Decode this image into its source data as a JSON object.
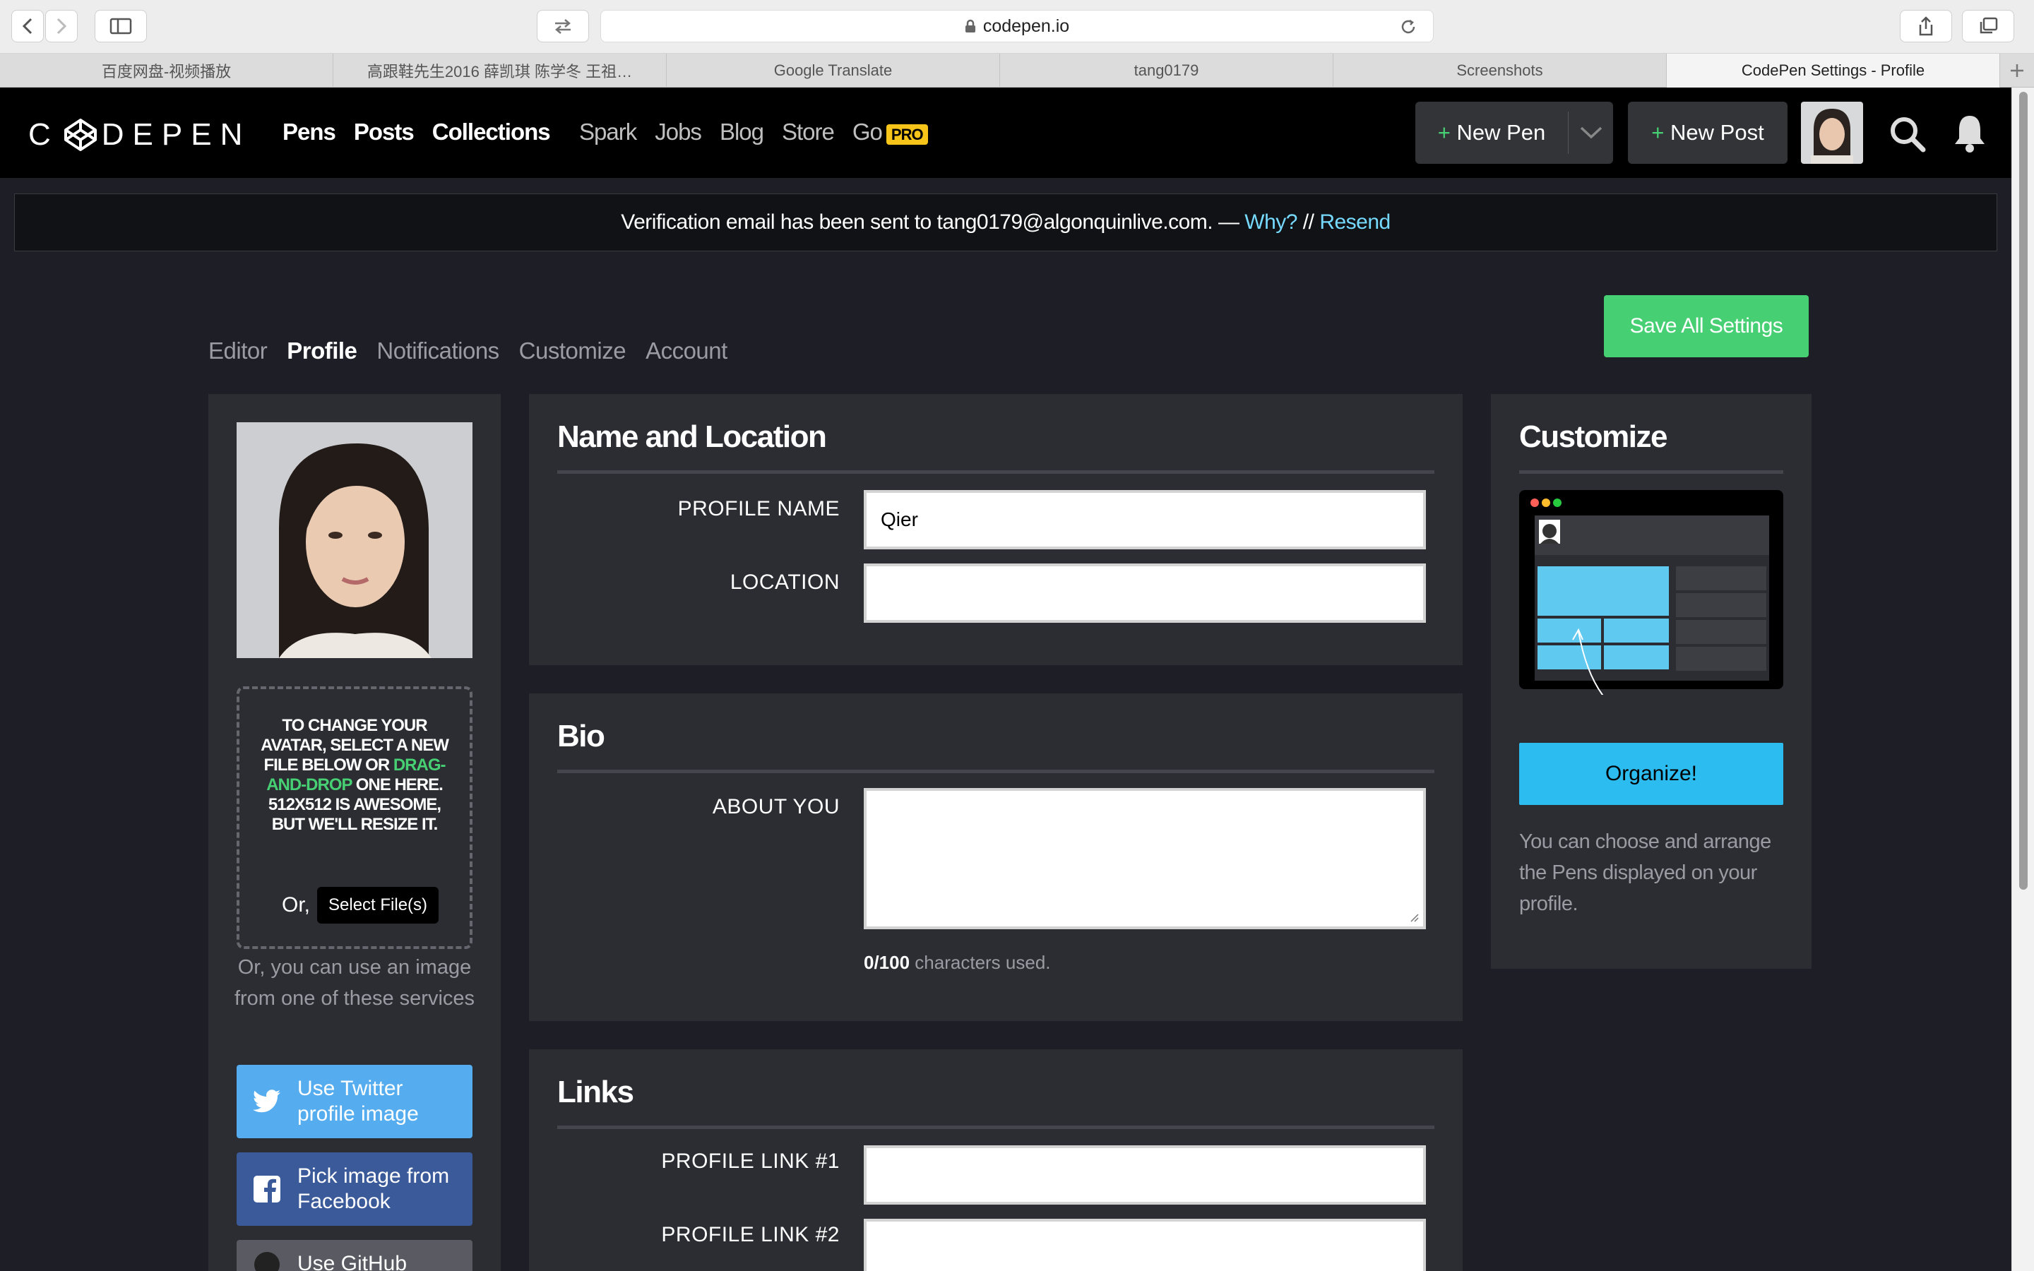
{
  "browser": {
    "url": "codepen.io",
    "tabs": [
      {
        "label": "百度网盘-视频播放",
        "active": false
      },
      {
        "label": "高跟鞋先生2016 薛凯琪 陈学冬 王祖…",
        "active": false
      },
      {
        "label": "Google Translate",
        "active": false
      },
      {
        "label": "tang0179",
        "active": false
      },
      {
        "label": "Screenshots",
        "active": false
      },
      {
        "label": "CodePen Settings - Profile",
        "active": true
      }
    ]
  },
  "header": {
    "logo_text": "CODEPEN",
    "nav_main": [
      "Pens",
      "Posts",
      "Collections"
    ],
    "nav_sub": [
      "Spark",
      "Jobs",
      "Blog",
      "Store",
      "Go"
    ],
    "pro_badge": "PRO",
    "new_pen_label": "New Pen",
    "new_post_label": "New Post",
    "plus": "+"
  },
  "banner": {
    "text": "Verification email has been sent to tang0179@algonquinlive.com. — ",
    "why": "Why?",
    "sep": " // ",
    "resend": "Resend"
  },
  "settings_nav": {
    "items": [
      "Editor",
      "Profile",
      "Notifications",
      "Customize",
      "Account"
    ],
    "active": "Profile"
  },
  "save_button": "Save All Settings",
  "left_panel": {
    "dropzone_line1": "To change your avatar, select a new file below or",
    "dropzone_green": "drag-and-drop",
    "dropzone_line2": "one here. 512x512 is awesome, but we'll resize it.",
    "or_label": "Or,",
    "select_files": "Select File(s)",
    "or_services": "Or, you can use an image from one of these services",
    "twitter": "Use Twitter profile image",
    "facebook": "Pick image from Facebook",
    "github": "Use GitHub"
  },
  "name_location": {
    "title": "Name and Location",
    "profile_name_label": "PROFILE NAME",
    "profile_name_value": "Qier",
    "location_label": "LOCATION",
    "location_value": ""
  },
  "bio": {
    "title": "Bio",
    "about_label": "ABOUT YOU",
    "about_value": "",
    "count": "0/100",
    "count_suffix": " characters used."
  },
  "links": {
    "title": "Links",
    "link1_label": "PROFILE LINK #1",
    "link1_value": "",
    "link2_label": "PROFILE LINK #2",
    "link2_value": ""
  },
  "customize": {
    "title": "Customize",
    "organize": "Organize!",
    "description": "You can choose and arrange the Pens displayed on your profile."
  },
  "colors": {
    "green": "#47cf73",
    "blue": "#2cbcf0",
    "link": "#76daff",
    "twitter": "#55acee",
    "facebook": "#3b5a9a",
    "pro": "#f7c51a"
  }
}
